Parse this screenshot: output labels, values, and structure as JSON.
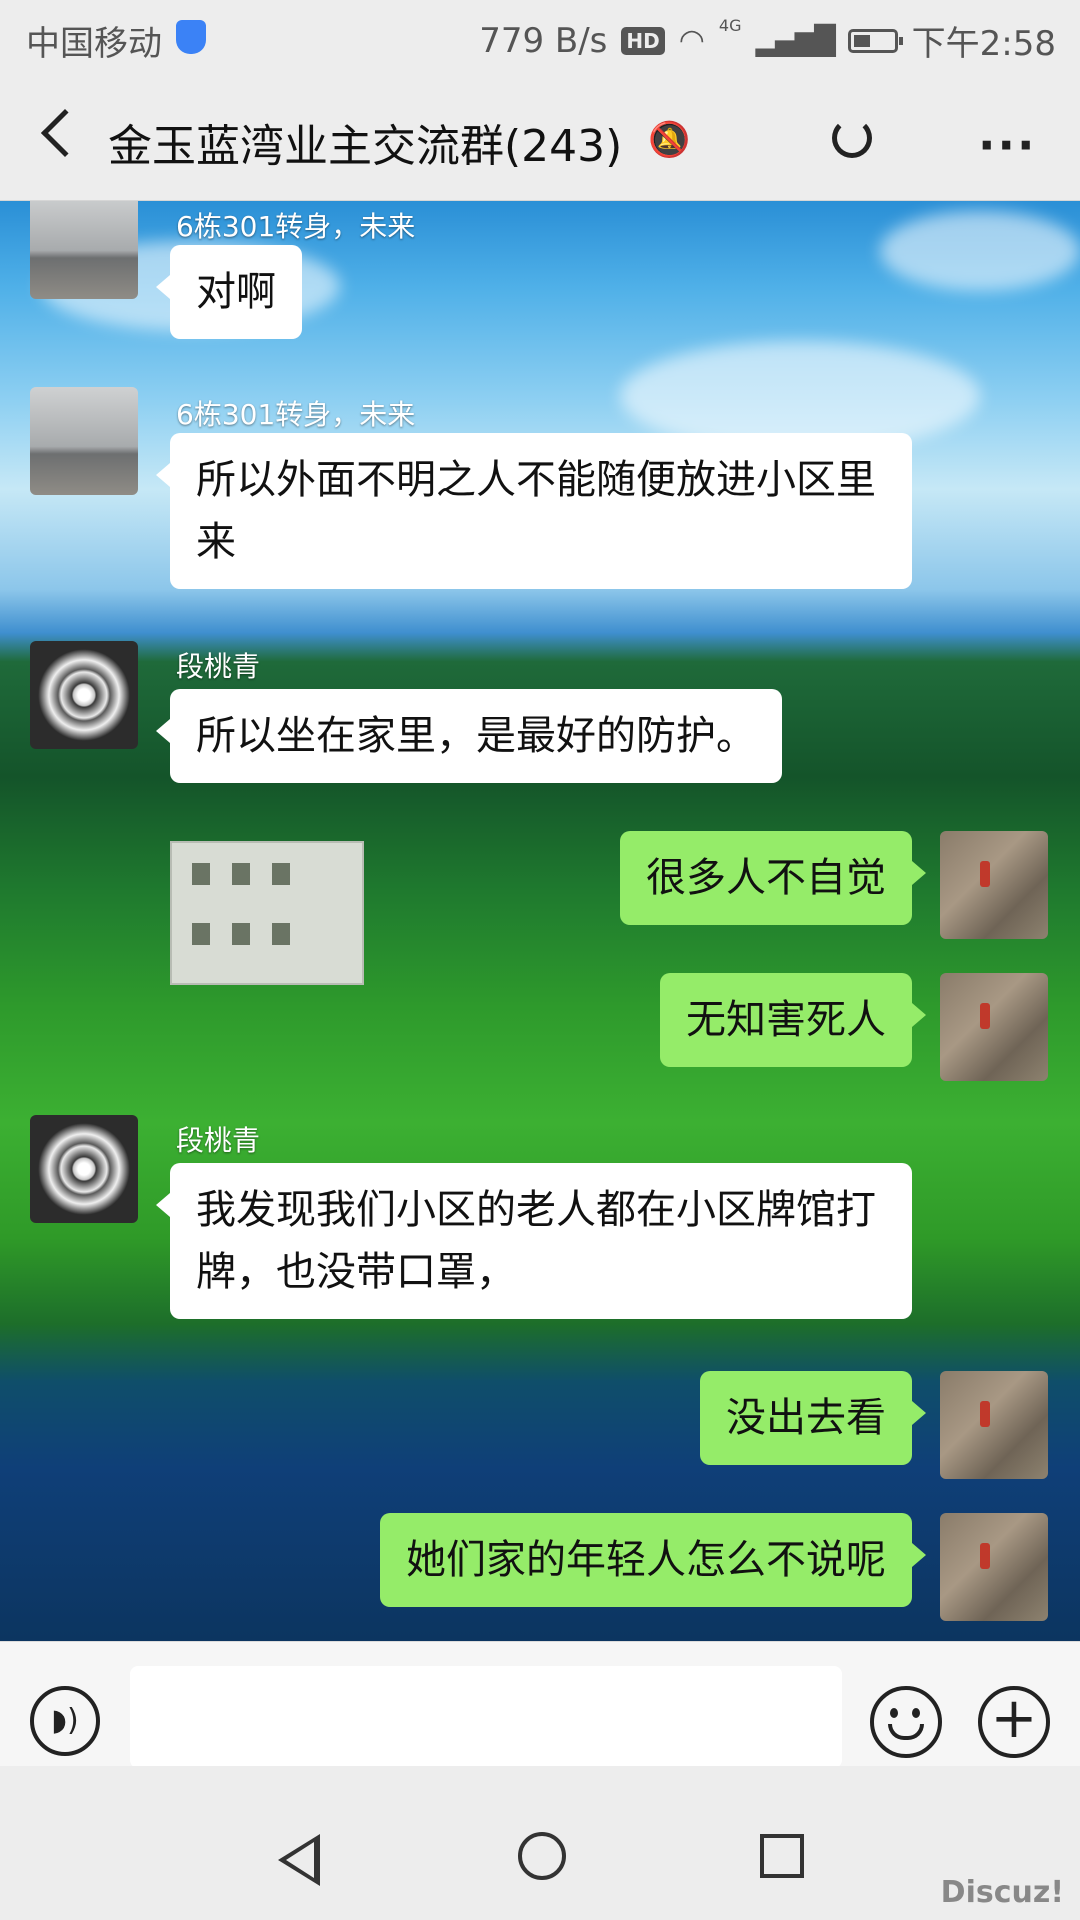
{
  "status_bar": {
    "carrier": "中国移动",
    "speed": "779 B/s",
    "hd": "HD",
    "network": "4G",
    "time": "下午2:58"
  },
  "title_bar": {
    "title": "金玉蓝湾业主交流群(243)",
    "icons": [
      "back-arrow-icon",
      "mute-bell-icon",
      "refresh-icon",
      "more-icon"
    ]
  },
  "messages": [
    {
      "side": "left",
      "sender": "6栋301转身，未来",
      "text": "对啊",
      "avatar": "gray"
    },
    {
      "side": "left",
      "sender": "6栋301转身，未来",
      "text": "所以外面不明之人不能随便放进小区里来",
      "avatar": "gray"
    },
    {
      "side": "left",
      "sender": "段桃青",
      "text": "所以坐在家里，是最好的防护。",
      "avatar": "flower"
    },
    {
      "side": "right",
      "text": "很多人不自觉",
      "avatar": "rock"
    },
    {
      "side": "right",
      "text": "无知害死人",
      "avatar": "rock"
    },
    {
      "side": "left",
      "sender": "段桃青",
      "text": "我发现我们小区的老人都在小区牌馆打牌，也没带口罩，",
      "avatar": "flower"
    },
    {
      "side": "right",
      "text": "没出去看",
      "avatar": "rock"
    },
    {
      "side": "right",
      "text": "她们家的年轻人怎么不说呢",
      "avatar": "rock"
    }
  ],
  "input_bar": {
    "placeholder": "",
    "icons": [
      "voice-icon",
      "emoji-icon",
      "plus-icon"
    ]
  },
  "nav_bar": {
    "icons": [
      "nav-back-icon",
      "nav-home-icon",
      "nav-recent-icon"
    ]
  },
  "watermark": "Discuz!"
}
